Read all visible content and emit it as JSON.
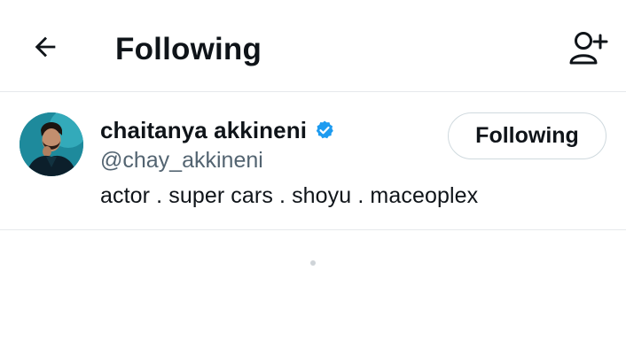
{
  "header": {
    "title": "Following",
    "back_icon": "arrow-left-icon",
    "add_icon": "add-user-icon"
  },
  "user": {
    "display_name": "chaitanya akkineni",
    "handle": "@chay_akkineni",
    "bio": "actor . super cars . shoyu . maceoplex",
    "verified": true,
    "follow_button_label": "Following"
  },
  "colors": {
    "text_primary": "#0f1419",
    "text_secondary": "#536471",
    "verified_blue": "#1d9bf0",
    "divider": "#e6e9ec",
    "button_border": "#cfd9de"
  }
}
